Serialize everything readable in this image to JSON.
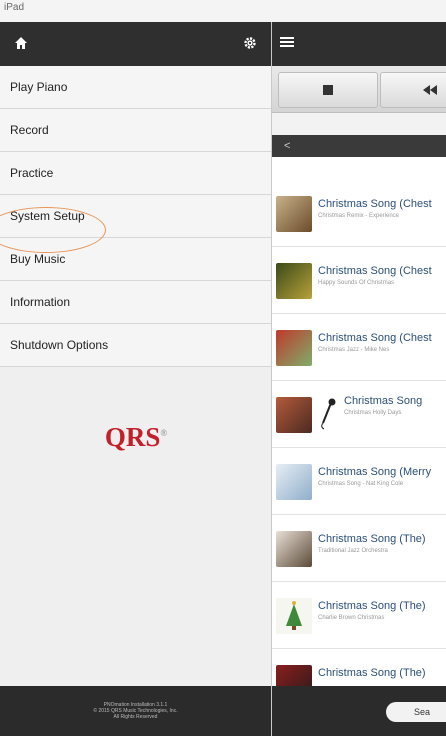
{
  "status_bar": {
    "carrier": "iPad",
    "time": ""
  },
  "menu": [
    {
      "label": "Play Piano"
    },
    {
      "label": "Record"
    },
    {
      "label": "Practice"
    },
    {
      "label": "System Setup"
    },
    {
      "label": "Buy Music"
    },
    {
      "label": "Information"
    },
    {
      "label": "Shutdown Options"
    }
  ],
  "logo": {
    "text": "QRS"
  },
  "footer": {
    "line1": "PNOmation Installation 3.1.1",
    "line2": "© 2015 QRS Music Technologies, Inc.",
    "line3": "All Rights Reserved"
  },
  "breadcrumb": {
    "label": "<"
  },
  "songs": [
    {
      "title": "Christmas Song (Chest",
      "subtitle": "Christmas Remix - Experience"
    },
    {
      "title": "Christmas Song (Chest",
      "subtitle": "Happy Sounds Of Christmas"
    },
    {
      "title": "Christmas Song (Chest",
      "subtitle": "Christmas Jazz - Mike Nes"
    },
    {
      "title": "Christmas Song",
      "subtitle": "Christmas Holly Days"
    },
    {
      "title": "Christmas Song (Merry",
      "subtitle": "Christmas Song - Nat King Cole"
    },
    {
      "title": "Christmas Song (The)",
      "subtitle": "Traditional Jazz Orchestra"
    },
    {
      "title": "Christmas Song (The)",
      "subtitle": "Charlie Brown Christmas"
    },
    {
      "title": "Christmas Song (The)",
      "subtitle": ""
    }
  ],
  "search": {
    "label": "Sea"
  },
  "colors": {
    "accent": "#c3202b",
    "highlight_circle": "#e8955a",
    "toolbar": "#2f2f2f"
  }
}
